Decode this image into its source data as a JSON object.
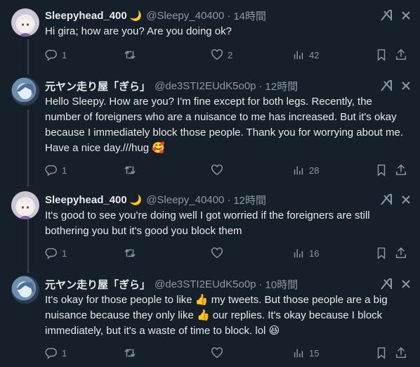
{
  "colors": {
    "background": "#15202b",
    "text": "#e7e9ea",
    "muted": "#8b98a5",
    "divider": "#38444d"
  },
  "tweets": [
    {
      "name": "Sleepyhead_400",
      "name_emoji": "🌙",
      "handle": "@Sleepy_40400",
      "dot": "·",
      "time": "14時間",
      "text": "Hi gira; how are you? Are you doing ok?",
      "replies": "1",
      "retweets": "",
      "likes": "2",
      "views": "42"
    },
    {
      "name": "元ヤン走り屋「ぎら」",
      "handle": "@de3STI2EUdK5o0p",
      "dot": "·",
      "time": "12時間",
      "text_a": "Hello Sleepy.  How are you? I'm fine except for both legs.  Recently, the number of foreigners who are a nuisance to me has increased.  But it's okay because I immediately block those people.  Thank you for worrying about me. Have a nice day.///hug",
      "emoji": "🥰",
      "replies": "1",
      "retweets": "",
      "likes": "",
      "views": "28"
    },
    {
      "name": "Sleepyhead_400",
      "name_emoji": "🌙",
      "handle": "@Sleepy_40400",
      "dot": "·",
      "time": "12時間",
      "text": "It's good to see you're doing well I got worried if the foreigners are still bothering you but it's good you block them",
      "replies": "1",
      "retweets": "",
      "likes": "",
      "views": "16"
    },
    {
      "name": "元ヤン走り屋「ぎら」",
      "handle": "@de3STI2EUdK5o0p",
      "dot": "·",
      "time": "10時間",
      "text_a": "It's okay for those people to like",
      "text_b": "my tweets.  But those people are a big nuisance because they only like",
      "text_c": "our replies.  It's okay because I block immediately, but it's a waste of time to block. lol",
      "emoji_like": "👍",
      "emoji_end": "😆",
      "replies": "1",
      "retweets": "",
      "likes": "",
      "views": "15"
    }
  ],
  "icons": {
    "reply": "reply-icon",
    "retweet": "retweet-icon",
    "like": "heart-icon",
    "views": "views-icon",
    "bookmark": "bookmark-icon",
    "share": "share-icon",
    "grok": "grok-icon",
    "more": "more-icon"
  }
}
